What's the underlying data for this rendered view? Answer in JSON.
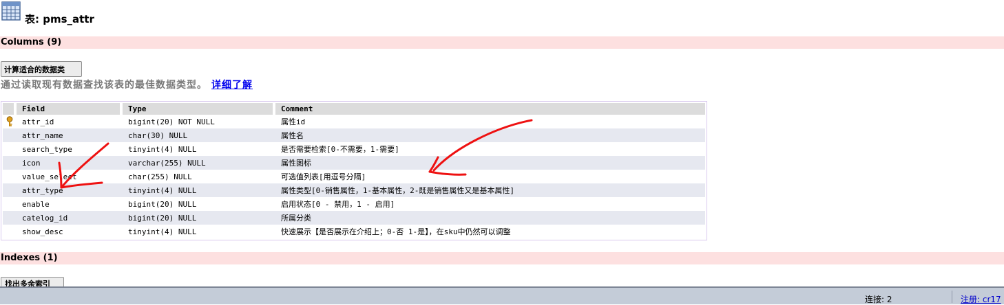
{
  "header": {
    "title": "表: pms_attr",
    "icon": "table-grid-icon"
  },
  "columns_section": {
    "title": "Columns (9)"
  },
  "calc": {
    "button_label": "计算适合的数据类",
    "description": "通过读取现有数据查找该表的最佳数据类型。",
    "link_label": "详细了解"
  },
  "columns_table": {
    "headers": {
      "field": "Field",
      "type": "Type",
      "comment": "Comment"
    },
    "rows": [
      {
        "field": "attr_id",
        "type": "bigint(20) NOT NULL",
        "comment": "属性id",
        "primary_key": true
      },
      {
        "field": "attr_name",
        "type": "char(30) NULL",
        "comment": "属性名"
      },
      {
        "field": "search_type",
        "type": "tinyint(4) NULL",
        "comment": "是否需要检索[0-不需要，1-需要]"
      },
      {
        "field": "icon",
        "type": "varchar(255) NULL",
        "comment": "属性图标"
      },
      {
        "field": "value_select",
        "type": "char(255) NULL",
        "comment": "可选值列表[用逗号分隔]"
      },
      {
        "field": "attr_type",
        "type": "tinyint(4) NULL",
        "comment": "属性类型[0-销售属性，1-基本属性，2-既是销售属性又是基本属性]"
      },
      {
        "field": "enable",
        "type": "bigint(20) NULL",
        "comment": "启用状态[0 - 禁用，1 - 启用]"
      },
      {
        "field": "catelog_id",
        "type": "bigint(20) NULL",
        "comment": "所属分类"
      },
      {
        "field": "show_desc",
        "type": "tinyint(4) NULL",
        "comment": "快速展示【是否展示在介绍上；0-否 1-是】，在sku中仍然可以调整"
      }
    ]
  },
  "indexes_section": {
    "title": "Indexes (1)"
  },
  "find_button": {
    "label": "找出多余索引"
  },
  "status_bar": {
    "connection": "连接: 2",
    "registration": "注册:  cr17"
  },
  "colors": {
    "section_bar": "#fde0e0",
    "even_row": "#e6e8f0",
    "annotation": "#ee1111",
    "link": "#0000ee"
  }
}
